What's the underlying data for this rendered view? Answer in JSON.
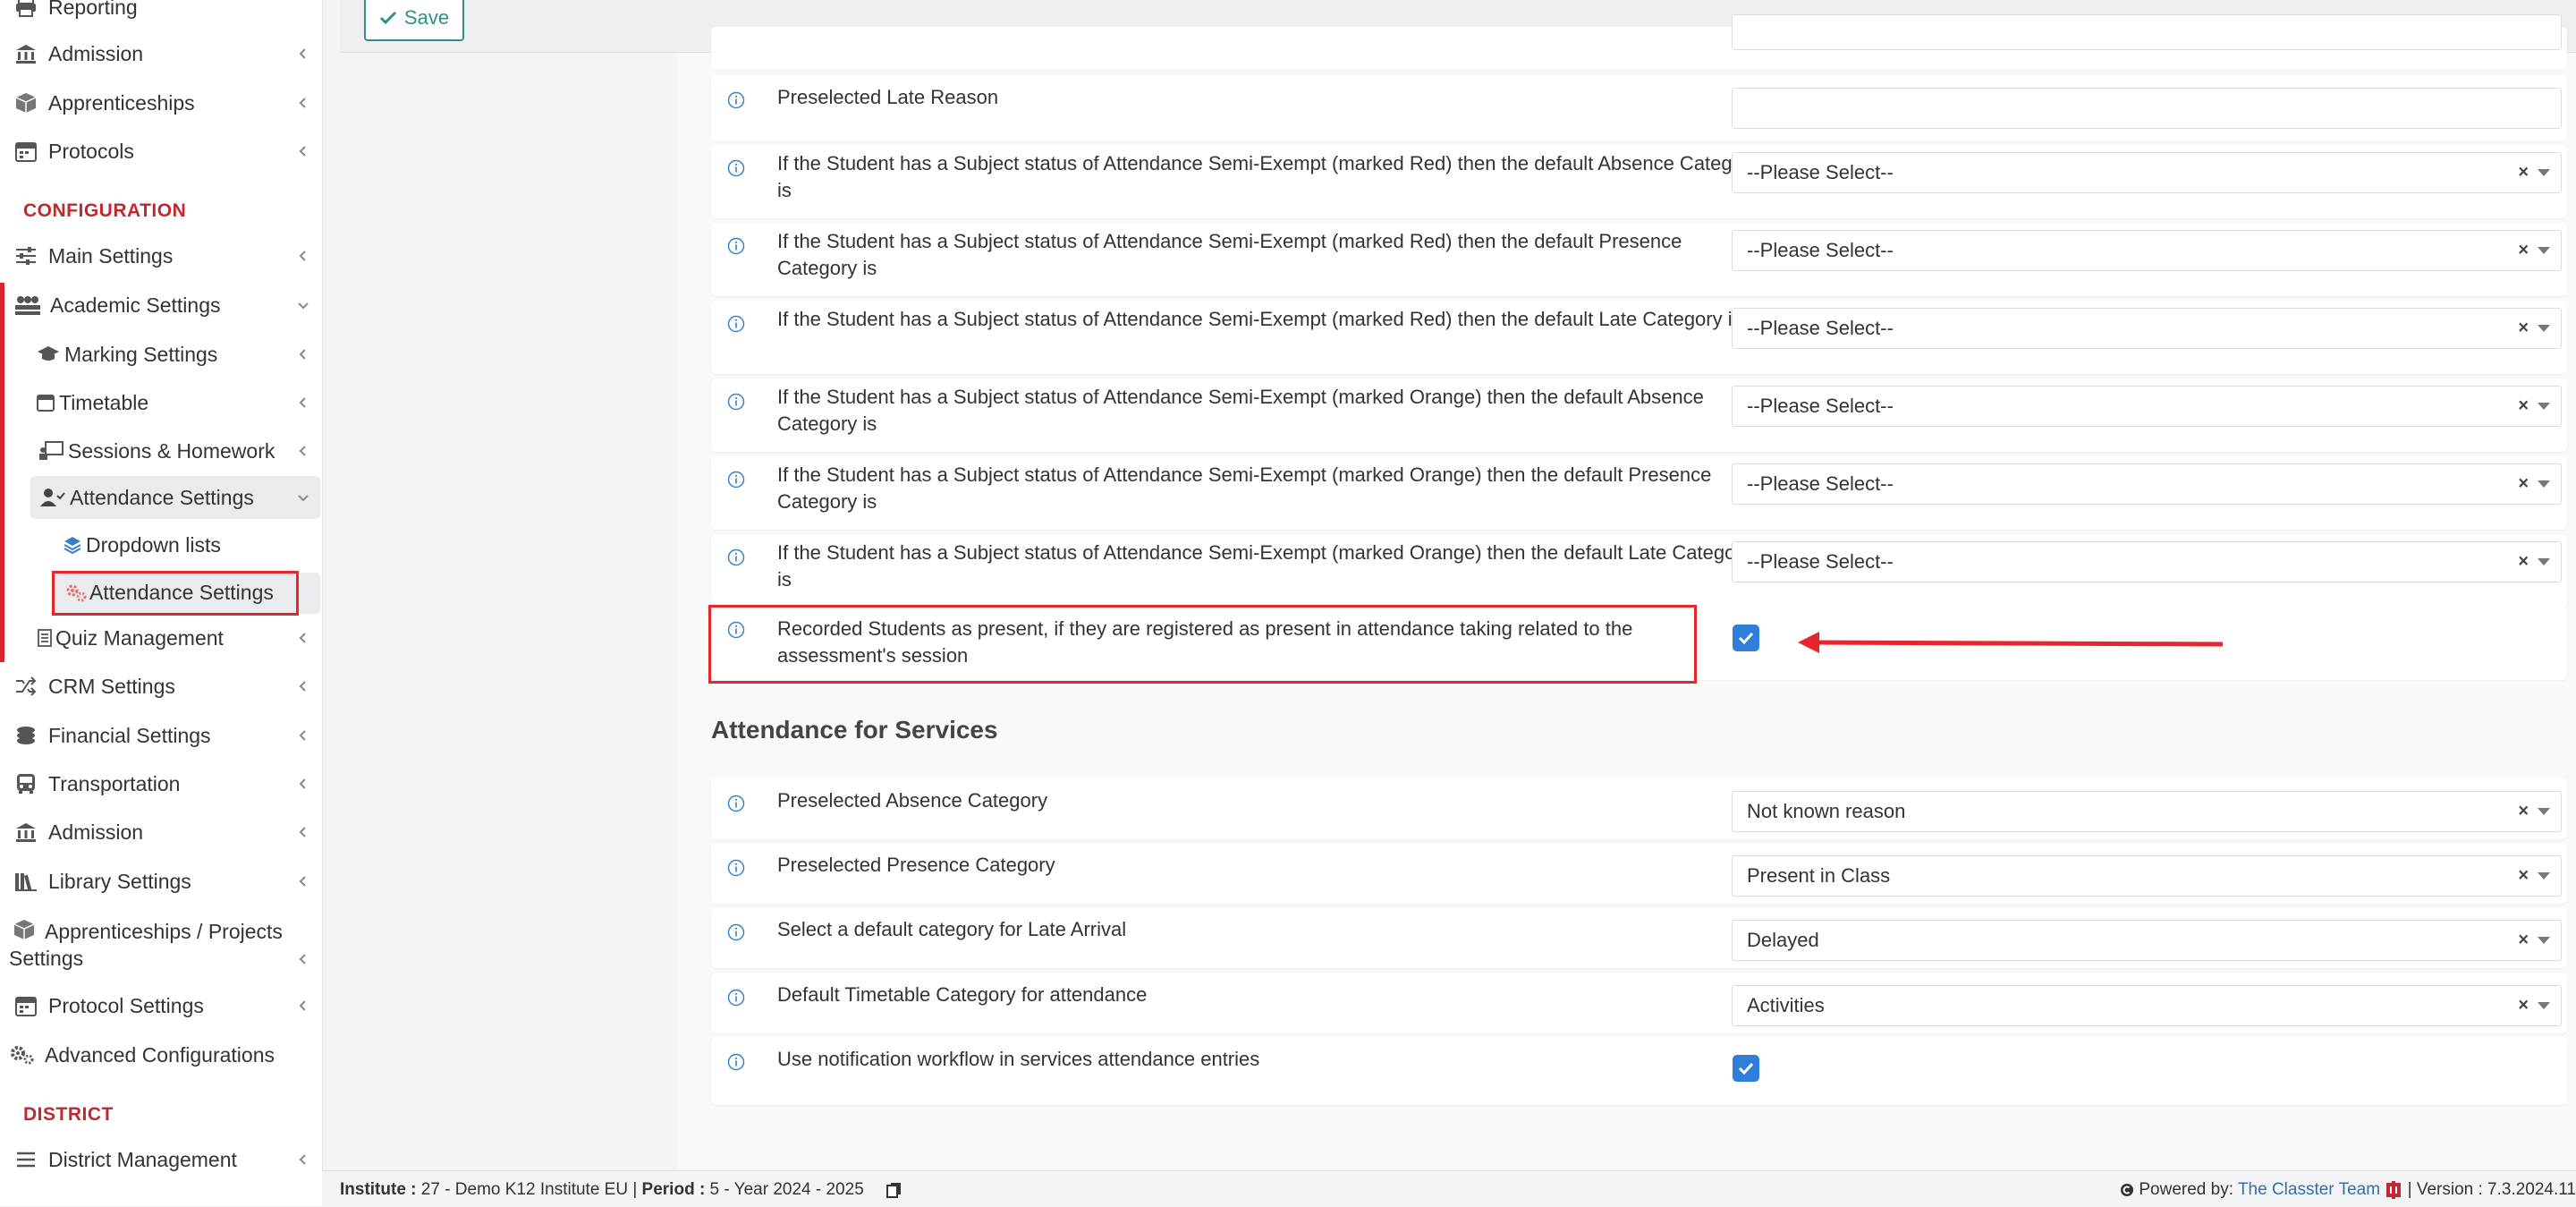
{
  "sidebar": {
    "items_top": [
      {
        "label": "Reporting",
        "icon": "printer-icon"
      },
      {
        "label": "Admission",
        "icon": "bank-icon"
      },
      {
        "label": "Apprenticeships",
        "icon": "box-icon"
      },
      {
        "label": "Protocols",
        "icon": "calendar-icon"
      }
    ],
    "config_section": "CONFIGURATION",
    "main_settings": "Main Settings",
    "academic_settings": "Academic Settings",
    "marking_settings": "Marking Settings",
    "timetable": "Timetable",
    "sessions_homework": "Sessions & Homework",
    "attendance_settings_group": "Attendance Settings",
    "dropdown_lists": "Dropdown lists",
    "attendance_settings_item": "Attendance Settings",
    "quiz_management": "Quiz Management",
    "items_bottom": [
      {
        "label": "CRM Settings",
        "icon": "shuffle-icon"
      },
      {
        "label": "Financial Settings",
        "icon": "coins-icon"
      },
      {
        "label": "Transportation",
        "icon": "bus-icon"
      },
      {
        "label": "Admission",
        "icon": "bank-icon"
      },
      {
        "label": "Library Settings",
        "icon": "books-icon"
      },
      {
        "label": "Apprenticeships / Projects Settings",
        "icon": "box-icon"
      },
      {
        "label": "Protocol Settings",
        "icon": "calendar-icon"
      },
      {
        "label": "Advanced Configurations",
        "icon": "gears-icon"
      }
    ],
    "district_section": "DISTRICT",
    "district_management": "District Management"
  },
  "toolbar": {
    "save_label": "Save"
  },
  "rows_top": [
    {
      "label": "Preselected Late Reason",
      "value": "",
      "type": "text"
    },
    {
      "label": "If the Student has a Subject status of Attendance Semi-Exempt (marked Red) then the default Absence Category is",
      "value": "--Please Select--",
      "type": "select"
    },
    {
      "label": "If the Student has a Subject status of Attendance Semi-Exempt (marked Red) then the default Presence Category is",
      "value": "--Please Select--",
      "type": "select"
    },
    {
      "label": "If the Student has a Subject status of Attendance Semi-Exempt (marked Red) then the default Late Category is",
      "value": "--Please Select--",
      "type": "select"
    },
    {
      "label": "If the Student has a Subject status of Attendance Semi-Exempt (marked Orange) then the default Absence Category is",
      "value": "--Please Select--",
      "type": "select"
    },
    {
      "label": "If the Student has a Subject status of Attendance Semi-Exempt (marked Orange) then the default Presence Category is",
      "value": "--Please Select--",
      "type": "select"
    },
    {
      "label": "If the Student has a Subject status of Attendance Semi-Exempt (marked Orange) then the default Late Category is",
      "value": "--Please Select--",
      "type": "select"
    }
  ],
  "recorded_row": {
    "label": "Recorded Students as present, if they are registered as present in attendance taking related to the assessment's session",
    "checked": true
  },
  "services": {
    "title": "Attendance for Services",
    "rows": [
      {
        "label": "Preselected Absence Category",
        "value": "Not known reason"
      },
      {
        "label": "Preselected Presence Category",
        "value": "Present in Class"
      },
      {
        "label": "Select a default category for Late Arrival",
        "value": "Delayed"
      },
      {
        "label": "Default Timetable Category for attendance",
        "value": "Activities"
      }
    ],
    "notification_label": "Use notification workflow in services attendance entries",
    "notification_checked": true
  },
  "footer": {
    "institute_label": "Institute :",
    "institute_value": " 27 - Demo K12 Institute EU | ",
    "period_label": "Period :",
    "period_value": " 5 - Year 2024 - 2025",
    "powered_label": "Powered by:",
    "powered_link": "The Classter Team",
    "version": "| Version : 7.3.2024.11"
  },
  "colors": {
    "accent": "#2f7ed8",
    "brand_red": "#c0292f",
    "save_teal": "#2f8f8a"
  }
}
